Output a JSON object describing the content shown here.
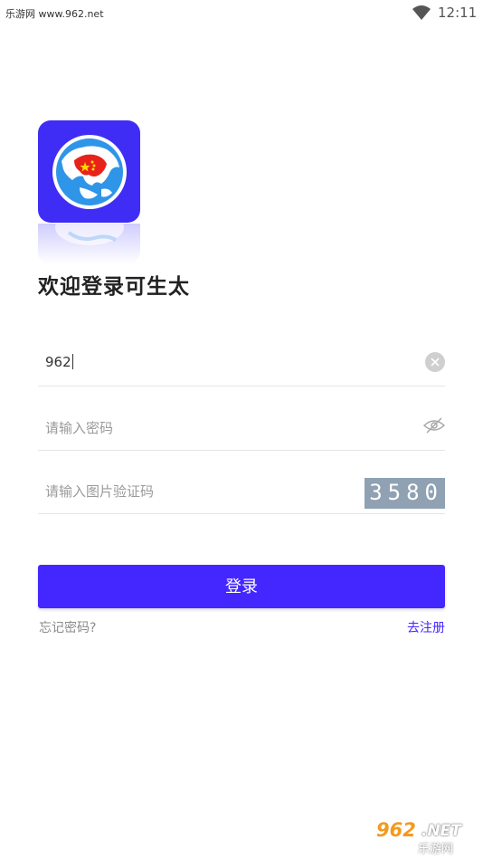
{
  "status_bar": {
    "left_text": "乐游网 www.962.net",
    "time": "12:11"
  },
  "login": {
    "welcome": "欢迎登录可生太",
    "username_value": "962",
    "password_placeholder": "请输入密码",
    "captcha_placeholder": "请输入图片验证码",
    "captcha_code": "3580",
    "login_label": "登录",
    "forgot_label": "忘记密码?",
    "register_label": "去注册"
  },
  "watermark": {
    "number": "962",
    "suffix": ".NET",
    "text": "乐游网"
  },
  "colors": {
    "accent": "#4427ff",
    "logo_bg": "#3f2df5",
    "captcha_bg": "#8fa1b3"
  }
}
